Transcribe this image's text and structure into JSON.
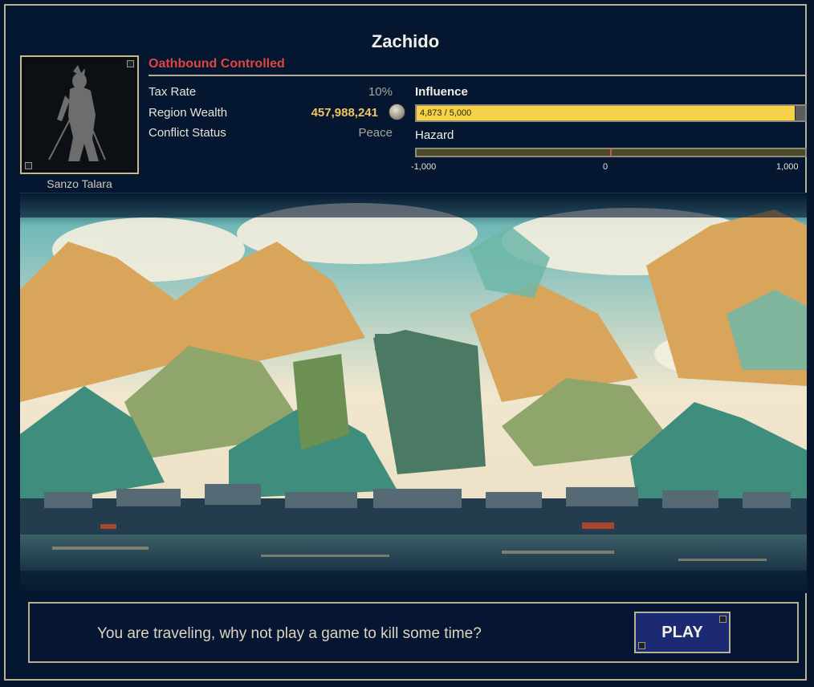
{
  "region": {
    "name": "Zachido",
    "owner": "Oathbound Controlled",
    "governor": "Sanzo Talara"
  },
  "stats": {
    "tax_rate_label": "Tax Rate",
    "tax_rate_value": "10%",
    "wealth_label": "Region Wealth",
    "wealth_value": "457,988,241",
    "conflict_label": "Conflict Status",
    "conflict_value": "Peace"
  },
  "influence": {
    "label": "Influence",
    "text": "4,873 / 5,000",
    "current": 4873,
    "max": 5000
  },
  "hazard": {
    "label": "Hazard",
    "min_label": "-1,000",
    "mid_label": "0",
    "max_label": "1,000",
    "value": 0
  },
  "travel": {
    "message": "You are traveling, why not play a game to kill some time?",
    "play_label": "PLAY"
  },
  "icons": {
    "coin": "silver-coin-icon",
    "portrait": "samurai-silhouette-icon",
    "corner": "corner-ornament-icon"
  },
  "colors": {
    "owner": "#e0463e",
    "influence_fill": "#f6d248",
    "wealth": "#f0c65f",
    "play_button": "#1b2a72",
    "border": "#b9b294"
  }
}
